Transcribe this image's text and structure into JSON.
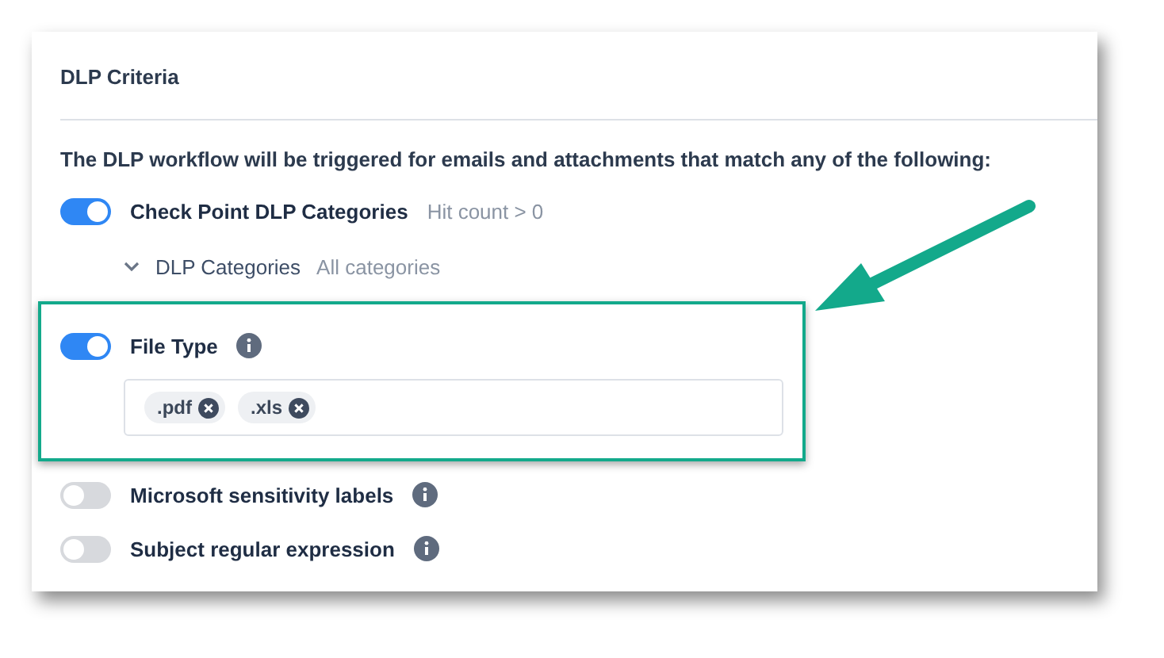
{
  "section": {
    "title": "DLP Criteria",
    "description": "The DLP workflow will be triggered for emails and attachments that match any of the following:"
  },
  "criteria": [
    {
      "kind": "toggle",
      "label": "Check Point DLP Categories",
      "hint": "Hit count > 0",
      "on": true,
      "info": false,
      "highlighted": false
    },
    {
      "kind": "sub",
      "label": "DLP Categories",
      "hint": "All categories",
      "expanded": true
    },
    {
      "kind": "toggle",
      "label": "File Type",
      "on": true,
      "info": true,
      "highlighted": true,
      "tags": [
        ".pdf",
        ".xls"
      ]
    },
    {
      "kind": "toggle",
      "label": "Microsoft sensitivity labels",
      "on": false,
      "info": true,
      "highlighted": false
    },
    {
      "kind": "toggle",
      "label": "Subject regular expression",
      "on": false,
      "info": true,
      "highlighted": false
    }
  ]
}
